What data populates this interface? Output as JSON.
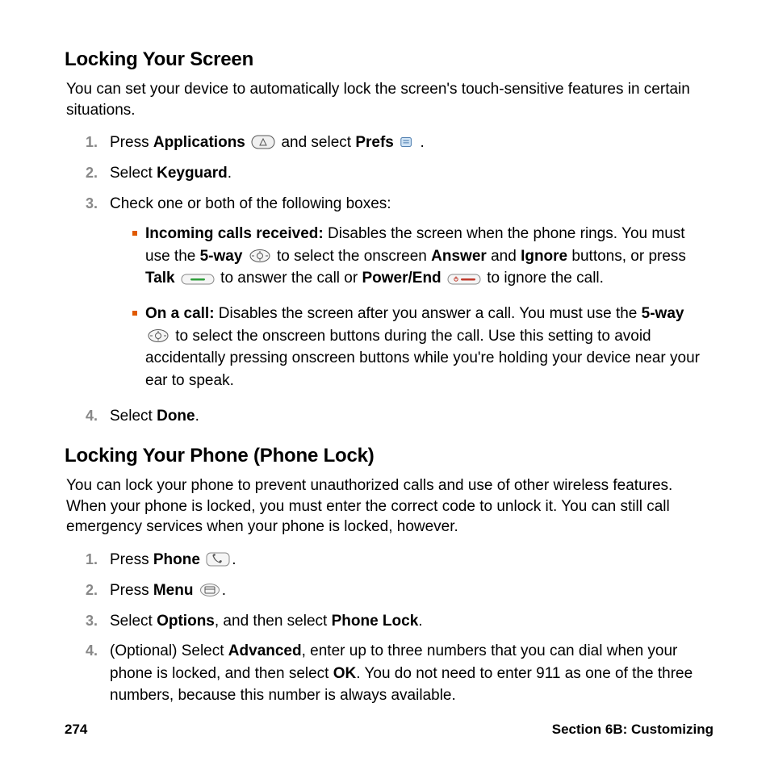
{
  "heading1": "Locking Your Screen",
  "intro1": "You can set your device to automatically lock the screen's touch-sensitive features in certain situations.",
  "s1_step1_a": "Press ",
  "s1_step1_b": "Applications",
  "s1_step1_c": " and select ",
  "s1_step1_d": "Prefs",
  "s1_step1_e": " .",
  "s1_step2_a": "Select ",
  "s1_step2_b": "Keyguard",
  "s1_step2_c": ".",
  "s1_step3": "Check one or both of the following boxes:",
  "s1_sub1_a": "Incoming calls received:",
  "s1_sub1_b": " Disables the screen when the phone rings. You must use the ",
  "s1_sub1_c": "5-way",
  "s1_sub1_d": " to select the onscreen ",
  "s1_sub1_e": "Answer",
  "s1_sub1_f": " and ",
  "s1_sub1_g": "Ignore",
  "s1_sub1_h": " buttons, or press ",
  "s1_sub1_i": "Talk",
  "s1_sub1_j": " to answer the call or ",
  "s1_sub1_k": "Power/End",
  "s1_sub1_l": " to ignore the call.",
  "s1_sub2_a": "On a call:",
  "s1_sub2_b": " Disables the screen after you answer a call. You must use the ",
  "s1_sub2_c": "5-way",
  "s1_sub2_d": " to select the onscreen buttons during the call. Use this setting to avoid accidentally pressing onscreen buttons while you're holding your device near your ear to speak.",
  "s1_step4_a": "Select ",
  "s1_step4_b": "Done",
  "s1_step4_c": ".",
  "heading2": "Locking Your Phone (Phone Lock)",
  "intro2": "You can lock your phone to prevent unauthorized calls and use of other wireless features. When your phone is locked, you must enter the correct code to unlock it. You can still call emergency services when your phone is locked, however.",
  "s2_step1_a": "Press ",
  "s2_step1_b": "Phone",
  "s2_step1_c": ".",
  "s2_step2_a": "Press ",
  "s2_step2_b": "Menu",
  "s2_step2_c": ".",
  "s2_step3_a": "Select ",
  "s2_step3_b": "Options",
  "s2_step3_c": ", and then select ",
  "s2_step3_d": "Phone Lock",
  "s2_step3_e": ".",
  "s2_step4_a": "(Optional) Select ",
  "s2_step4_b": "Advanced",
  "s2_step4_c": ", enter up to three numbers that you can dial when your phone is locked, and then select ",
  "s2_step4_d": "OK",
  "s2_step4_e": ". You do not need to enter 911 as one of the three numbers, because this number is always available.",
  "footer_page": "274",
  "footer_section": "Section 6B: Customizing"
}
